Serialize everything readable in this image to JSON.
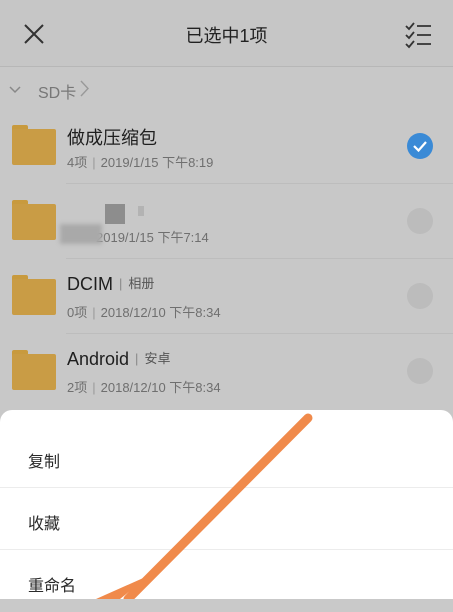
{
  "header": {
    "title": "已选中1项",
    "close_icon": "close-icon",
    "select_all_icon": "checklist-icon"
  },
  "breadcrumb": {
    "label": "SD卡"
  },
  "rows": [
    {
      "name": "做成压缩包",
      "tag": "",
      "count": "4项",
      "date": "2019/1/15 下午8:19",
      "checked": true
    },
    {
      "name": "",
      "tag": "",
      "count": "",
      "date": "2019/1/15 下午7:14",
      "checked": false
    },
    {
      "name": "DCIM",
      "tag": "相册",
      "count": "0项",
      "date": "2018/12/10 下午8:34",
      "checked": false
    },
    {
      "name": "Android",
      "tag": "安卓",
      "count": "2项",
      "date": "2018/12/10 下午8:34",
      "checked": false
    }
  ],
  "sheet": {
    "items": [
      "复制",
      "收藏",
      "重命名"
    ]
  },
  "colors": {
    "accent": "#3a8ad6",
    "folder": "#c99c45",
    "arrow": "#f08a4b"
  }
}
